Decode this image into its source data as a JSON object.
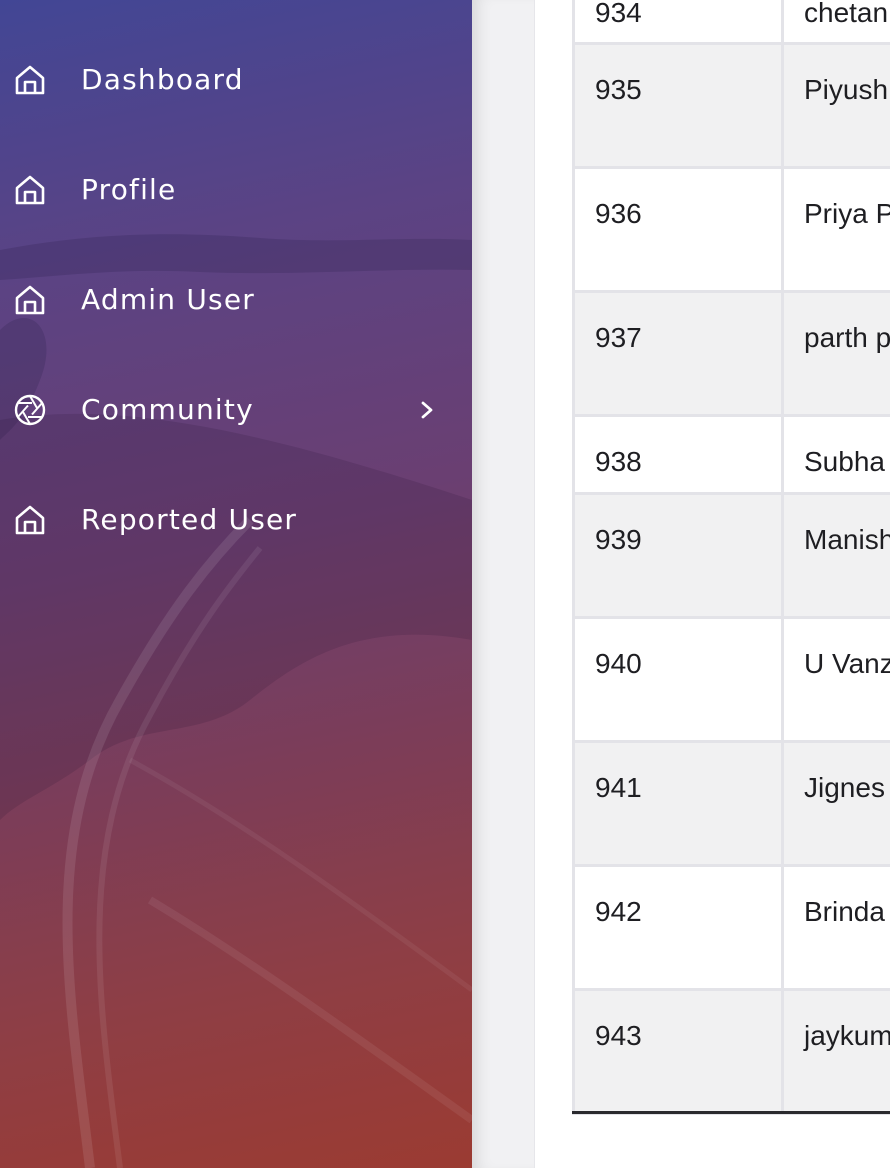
{
  "sidebar": {
    "items": [
      {
        "label": "Dashboard",
        "icon": "home-icon"
      },
      {
        "label": "Profile",
        "icon": "home-icon"
      },
      {
        "label": "Admin User",
        "icon": "home-icon"
      },
      {
        "label": "Community",
        "icon": "aperture-icon",
        "has_submenu": true
      },
      {
        "label": "Reported User",
        "icon": "home-icon"
      }
    ]
  },
  "table": {
    "rows": [
      {
        "id": "934",
        "name": "chetan"
      },
      {
        "id": "935",
        "name": "Piyush"
      },
      {
        "id": "936",
        "name": "Priya P"
      },
      {
        "id": "937",
        "name": "parth p"
      },
      {
        "id": "938",
        "name": "Subha"
      },
      {
        "id": "939",
        "name": "Manish"
      },
      {
        "id": "940",
        "name": "U Vanz"
      },
      {
        "id": "941",
        "name": "Jignes"
      },
      {
        "id": "942",
        "name": "Brinda Patel"
      },
      {
        "id": "943",
        "name": "jaykum"
      }
    ]
  },
  "colors": {
    "sidebar_gradient_top": "#424695",
    "sidebar_gradient_bottom": "#9b3b32",
    "row_striped": "#f1f1f2",
    "table_border": "#e3e3e8"
  }
}
